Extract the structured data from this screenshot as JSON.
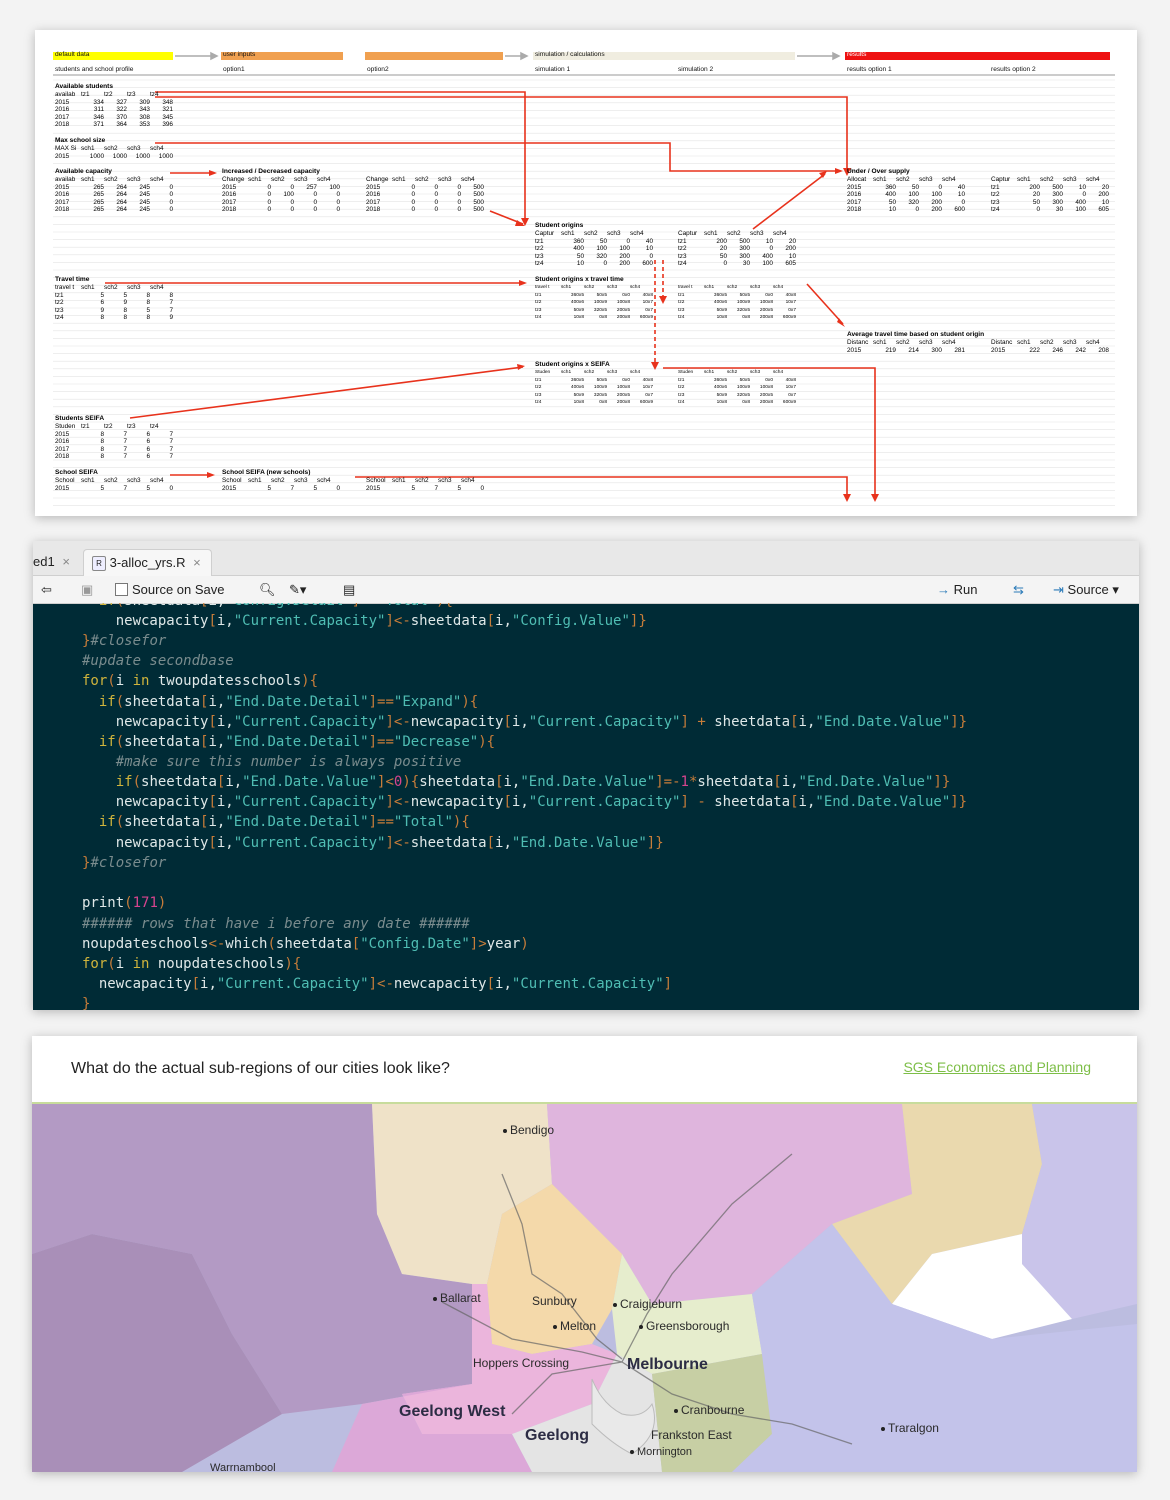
{
  "sheet": {
    "headers": {
      "default_data": "default data",
      "user_inputs": "user inputs",
      "simulation": "simulation / calculations",
      "results": "results"
    },
    "subheaders": [
      "students and school profile",
      "option1",
      "option2",
      "simulation 1",
      "simulation 2",
      "results option 1",
      "results option 2"
    ],
    "blocks": {
      "available_students": {
        "title": "Available students",
        "head": [
          "availab",
          "tz1",
          "tz2",
          "tz3",
          "tz4"
        ],
        "rows": [
          [
            "2015",
            "334",
            "327",
            "309",
            "348"
          ],
          [
            "2016",
            "311",
            "322",
            "343",
            "321"
          ],
          [
            "2017",
            "346",
            "370",
            "308",
            "345"
          ],
          [
            "2018",
            "371",
            "364",
            "353",
            "396"
          ]
        ]
      },
      "max_school_size": {
        "title": "Max school size",
        "head": [
          "MAX Si",
          "sch1",
          "sch2",
          "sch3",
          "sch4"
        ],
        "rows": [
          [
            "2015",
            "1000",
            "1000",
            "1000",
            "1000"
          ]
        ]
      },
      "available_capacity": {
        "title": "Available capacity",
        "head": [
          "availab",
          "sch1",
          "sch2",
          "sch3",
          "sch4"
        ],
        "rows": [
          [
            "2015",
            "265",
            "264",
            "245",
            "0"
          ],
          [
            "2016",
            "265",
            "264",
            "245",
            "0"
          ],
          [
            "2017",
            "265",
            "264",
            "245",
            "0"
          ],
          [
            "2018",
            "265",
            "264",
            "245",
            "0"
          ]
        ]
      },
      "increased_capacity": {
        "title": "Increased / Decreased capacity",
        "head": [
          "Change",
          "sch1",
          "sch2",
          "sch3",
          "sch4"
        ],
        "rows": [
          [
            "2015",
            "0",
            "0",
            "257",
            "100"
          ],
          [
            "2016",
            "0",
            "100",
            "0",
            "0"
          ],
          [
            "2017",
            "0",
            "0",
            "0",
            "0"
          ],
          [
            "2018",
            "0",
            "0",
            "0",
            "0"
          ]
        ]
      },
      "option2_capacity": {
        "title": "",
        "head": [
          "Change",
          "sch1",
          "sch2",
          "sch3",
          "sch4"
        ],
        "rows": [
          [
            "2015",
            "0",
            "0",
            "0",
            "500"
          ],
          [
            "2016",
            "0",
            "0",
            "0",
            "500"
          ],
          [
            "2017",
            "0",
            "0",
            "0",
            "500"
          ],
          [
            "2018",
            "0",
            "0",
            "0",
            "500"
          ]
        ]
      },
      "under_over": {
        "title": "Under / Over supply",
        "head": [
          "Allocat",
          "sch1",
          "sch2",
          "sch3",
          "sch4"
        ],
        "rows": [
          [
            "2015",
            "360",
            "50",
            "0",
            "40"
          ],
          [
            "2016",
            "400",
            "100",
            "100",
            "10"
          ],
          [
            "2017",
            "50",
            "320",
            "200",
            "0"
          ],
          [
            "2018",
            "10",
            "0",
            "200",
            "600"
          ]
        ]
      },
      "under_over2": {
        "title": "",
        "head": [
          "Captur",
          "sch1",
          "sch2",
          "sch3",
          "sch4"
        ],
        "rows": [
          [
            "tz1",
            "200",
            "500",
            "10",
            "20"
          ],
          [
            "tz2",
            "20",
            "300",
            "0",
            "200"
          ],
          [
            "tz3",
            "50",
            "300",
            "400",
            "10"
          ],
          [
            "tz4",
            "0",
            "30",
            "100",
            "605"
          ]
        ]
      },
      "student_origins": {
        "title": "Student origins",
        "head": [
          "Captur",
          "sch1",
          "sch2",
          "sch3",
          "sch4"
        ],
        "rows": [
          [
            "tz1",
            "360",
            "50",
            "0",
            "40"
          ],
          [
            "tz2",
            "400",
            "100",
            "100",
            "10"
          ],
          [
            "tz3",
            "50",
            "320",
            "200",
            "0"
          ],
          [
            "tz4",
            "10",
            "0",
            "200",
            "600"
          ]
        ]
      },
      "student_origins2": {
        "title": "",
        "head": [
          "Captur",
          "sch1",
          "sch2",
          "sch3",
          "sch4"
        ],
        "rows": [
          [
            "tz1",
            "200",
            "500",
            "10",
            "20"
          ],
          [
            "tz2",
            "20",
            "300",
            "0",
            "200"
          ],
          [
            "tz3",
            "50",
            "300",
            "400",
            "10"
          ],
          [
            "tz4",
            "0",
            "30",
            "100",
            "605"
          ]
        ]
      },
      "travel_time": {
        "title": "Travel time",
        "head": [
          "travel t",
          "sch1",
          "sch2",
          "sch3",
          "sch4"
        ],
        "rows": [
          [
            "tz1",
            "5",
            "5",
            "8",
            "8"
          ],
          [
            "tz2",
            "6",
            "9",
            "8",
            "7"
          ],
          [
            "tz3",
            "9",
            "8",
            "5",
            "7"
          ],
          [
            "tz4",
            "8",
            "8",
            "8",
            "9"
          ]
        ]
      },
      "origins_x_travel": {
        "title": "Student origins x travel time",
        "head": [
          "travel t",
          "sch1",
          "sch2",
          "sch3",
          "sch4"
        ],
        "rows": [
          [
            "tz1",
            "360x5",
            "50x5",
            "0x0",
            "40x8"
          ],
          [
            "tz2",
            "400x6",
            "100x9",
            "100x8",
            "10x7"
          ],
          [
            "tz3",
            "50x9",
            "320x5",
            "200x5",
            "0x7"
          ],
          [
            "tz4",
            "10x8",
            "0x8",
            "200x8",
            "600x9"
          ]
        ]
      },
      "origins_x_travel2": {
        "title": "",
        "head": [
          "travel t",
          "sch1",
          "sch2",
          "sch3",
          "sch4"
        ],
        "rows": [
          [
            "tz1",
            "360x5",
            "50x5",
            "0x0",
            "40x8"
          ],
          [
            "tz2",
            "400x6",
            "100x9",
            "100x8",
            "10x7"
          ],
          [
            "tz3",
            "50x9",
            "320x5",
            "200x5",
            "0x7"
          ],
          [
            "tz4",
            "10x8",
            "0x8",
            "200x8",
            "600x9"
          ]
        ]
      },
      "avg_travel": {
        "title": "Average travel time based on student origin",
        "head": [
          "Distanc",
          "sch1",
          "sch2",
          "sch3",
          "sch4"
        ],
        "rows": [
          [
            "2015",
            "219",
            "214",
            "300",
            "281"
          ]
        ]
      },
      "avg_travel2": {
        "title": "",
        "head": [
          "Distanc",
          "sch1",
          "sch2",
          "sch3",
          "sch4"
        ],
        "rows": [
          [
            "2015",
            "222",
            "246",
            "242",
            "208"
          ]
        ]
      },
      "origins_x_seifa": {
        "title": "Student origins x SEIFA",
        "head": [
          "Studen",
          "sch1",
          "sch2",
          "sch3",
          "sch4"
        ],
        "rows": [
          [
            "tz1",
            "360x5",
            "50x5",
            "0x0",
            "40x8"
          ],
          [
            "tz2",
            "400x6",
            "100x9",
            "100x8",
            "10x7"
          ],
          [
            "tz3",
            "50x9",
            "320x5",
            "200x5",
            "0x7"
          ],
          [
            "tz4",
            "10x8",
            "0x8",
            "200x8",
            "600x9"
          ]
        ]
      },
      "origins_x_seifa2": {
        "title": "",
        "head": [
          "Studen",
          "sch1",
          "sch2",
          "sch3",
          "sch4"
        ],
        "rows": [
          [
            "tz1",
            "360x5",
            "50x5",
            "0x0",
            "40x8"
          ],
          [
            "tz2",
            "400x6",
            "100x9",
            "100x8",
            "10x7"
          ],
          [
            "tz3",
            "50x9",
            "320x5",
            "200x5",
            "0x7"
          ],
          [
            "tz4",
            "10x8",
            "0x8",
            "200x8",
            "600x9"
          ]
        ]
      },
      "students_seifa": {
        "title": "Students SEIFA",
        "head": [
          "Studen",
          "tz1",
          "tz2",
          "tz3",
          "tz4"
        ],
        "rows": [
          [
            "2015",
            "8",
            "7",
            "6",
            "7"
          ],
          [
            "2016",
            "8",
            "7",
            "6",
            "7"
          ],
          [
            "2017",
            "8",
            "7",
            "6",
            "7"
          ],
          [
            "2018",
            "8",
            "7",
            "6",
            "7"
          ]
        ]
      },
      "school_seifa": {
        "title": "School SEIFA",
        "head": [
          "School",
          "sch1",
          "sch2",
          "sch3",
          "sch4"
        ],
        "rows": [
          [
            "2015",
            "5",
            "7",
            "5",
            "0"
          ]
        ]
      },
      "school_seifa_new": {
        "title": "School SEIFA (new schools)",
        "head": [
          "School",
          "sch1",
          "sch2",
          "sch3",
          "sch4"
        ],
        "rows": [
          [
            "2015",
            "5",
            "7",
            "5",
            "0"
          ]
        ]
      },
      "school_seifa_new2": {
        "title": "",
        "head": [
          "School",
          "sch1",
          "sch2",
          "sch3",
          "sch4"
        ],
        "rows": [
          [
            "2015",
            "5",
            "7",
            "5",
            "0"
          ]
        ]
      }
    }
  },
  "editor": {
    "tab_prev": "ed1",
    "tab_active": "3-alloc_yrs.R",
    "source_on_save": "Source on Save",
    "run": "Run",
    "source": "Source"
  },
  "map": {
    "question": "What do the actual sub-regions of our cities look like?",
    "link": "SGS Economics and Planning",
    "places": [
      "Bendigo",
      "Ballarat",
      "Sunbury",
      "Craigieburn",
      "Melton",
      "Greensborough",
      "Hoppers Crossing",
      "Melbourne",
      "Geelong West",
      "Cranbourne",
      "Geelong",
      "Frankston East",
      "Mornington",
      "Traralgon",
      "Warrnambool"
    ]
  },
  "colors": {
    "sheet_yellow": "#ffff00",
    "sheet_orange": "#f0a050",
    "sheet_red": "#ee1111",
    "arrow_red": "#e8321c",
    "editor_bg": "#002b36",
    "map_link": "#7dbe47"
  }
}
